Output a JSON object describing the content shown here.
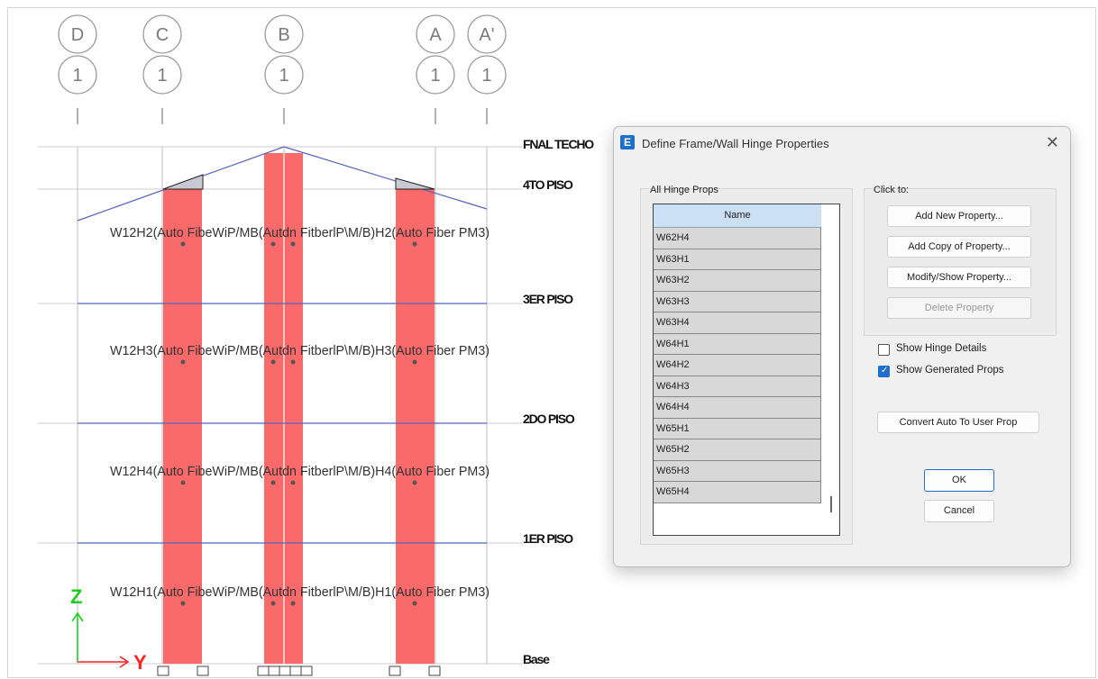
{
  "grid_bubbles": {
    "letters": [
      "D",
      "C",
      "B",
      "A",
      "A'"
    ],
    "numbers": [
      "1",
      "1",
      "1",
      "1",
      "1"
    ]
  },
  "stories": [
    "FNAL TECHO",
    "4TO PISO",
    "3ER PISO",
    "2DO PISO",
    "1ER PISO",
    "Base"
  ],
  "hinge_labels": {
    "row1": "W12H2(Auto FibeWiP/MB(Autdn FitberlP\\M/B)H2(Auto Fiber PM3)",
    "row2": "W12H3(Auto FibeWiP/MB(Autdn FitberlP\\M/B)H3(Auto Fiber PM3)",
    "row3": "W12H4(Auto FibeWiP/MB(Autdn FitberlP\\M/B)H4(Auto Fiber PM3)",
    "row4": "W12H1(Auto FibeWiP/MB(Autdn FitberlP\\M/B)H1(Auto Fiber PM3)"
  },
  "axes": {
    "z_label": "Z",
    "y_label": "Y",
    "z_color": "#22cc22",
    "y_color": "#ff2222"
  },
  "colors": {
    "wall_fill": "#fa6a6a",
    "beam_line": "#5566bb",
    "grid_line": "#bdbdbd"
  },
  "dialog": {
    "icon_letter": "E",
    "title": "Define Frame/Wall Hinge Properties",
    "close_glyph": "✕",
    "all_hinge_props_label": "All Hinge Props",
    "list_header": "Name",
    "list_items": [
      "W62H4",
      "W63H1",
      "W63H2",
      "W63H3",
      "W63H4",
      "W64H1",
      "W64H2",
      "W64H3",
      "W64H4",
      "W65H1",
      "W65H2",
      "W65H3",
      "W65H4"
    ],
    "click_to_label": "Click to:",
    "buttons": {
      "add_new": "Add New Property...",
      "add_copy": "Add Copy of Property...",
      "modify_show": "Modify/Show Property...",
      "delete": "Delete Property",
      "convert": "Convert Auto To User Prop",
      "ok": "OK",
      "cancel": "Cancel"
    },
    "checkboxes": {
      "show_hinge_details": {
        "label": "Show Hinge Details",
        "checked": false
      },
      "show_generated_props": {
        "label": "Show Generated Props",
        "checked": true
      }
    }
  }
}
